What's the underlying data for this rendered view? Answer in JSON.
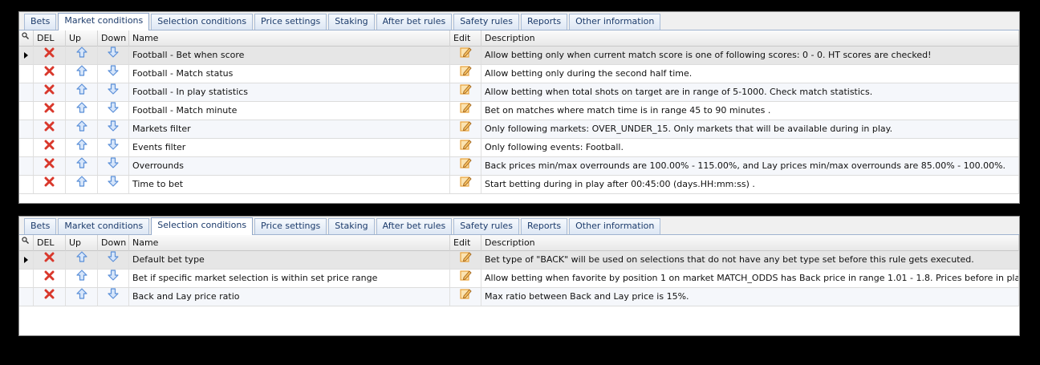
{
  "tabs": [
    "Bets",
    "Market conditions",
    "Selection conditions",
    "Price settings",
    "Staking",
    "After bet rules",
    "Safety rules",
    "Reports",
    "Other information"
  ],
  "columns": {
    "search_icon": "search-icon",
    "del": "DEL",
    "up": "Up",
    "down": "Down",
    "name": "Name",
    "edit": "Edit",
    "description": "Description"
  },
  "panels": [
    {
      "active_tab": "Market conditions",
      "rows": [
        {
          "name": "Football - Bet when score",
          "description": "Allow betting only when current match score is one of following scores: 0 - 0. HT scores are checked!"
        },
        {
          "name": "Football - Match status",
          "description": "Allow betting only during the second half time."
        },
        {
          "name": "Football - In play statistics",
          "description": "Allow betting when total shots on target are in range of 5-1000. Check match statistics."
        },
        {
          "name": "Football - Match minute",
          "description": "Bet on matches where match time is in range 45 to 90 minutes ."
        },
        {
          "name": "Markets filter",
          "description": "Only following markets: OVER_UNDER_15. Only markets that will be available during in play."
        },
        {
          "name": "Events filter",
          "description": "Only following events: Football."
        },
        {
          "name": "Overrounds",
          "description": "Back prices min/max overrounds are 100.00% - 115.00%, and Lay prices min/max overrounds are 85.00% - 100.00%."
        },
        {
          "name": "Time to bet",
          "description": "Start betting during in play after 00:45:00 (days.HH:mm:ss) ."
        }
      ]
    },
    {
      "active_tab": "Selection conditions",
      "rows": [
        {
          "name": "Default bet type",
          "description": "Bet type of \"BACK\" will be used on selections that do not have any bet type set before this rule gets executed."
        },
        {
          "name": "Bet if specific market selection is within set price range",
          "description": "Allow betting when favorite by position 1 on market MATCH_ODDS has Back price in range 1.01 - 1.8. Prices before in play are checked."
        },
        {
          "name": "Back and Lay price ratio",
          "description": "Max ratio between Back and Lay price is 15%."
        }
      ]
    }
  ],
  "colors": {
    "delete": "#d9382c",
    "arrow": "#5a8fd8",
    "edit": "#e8a23a",
    "tab_text": "#1c3b6b"
  }
}
